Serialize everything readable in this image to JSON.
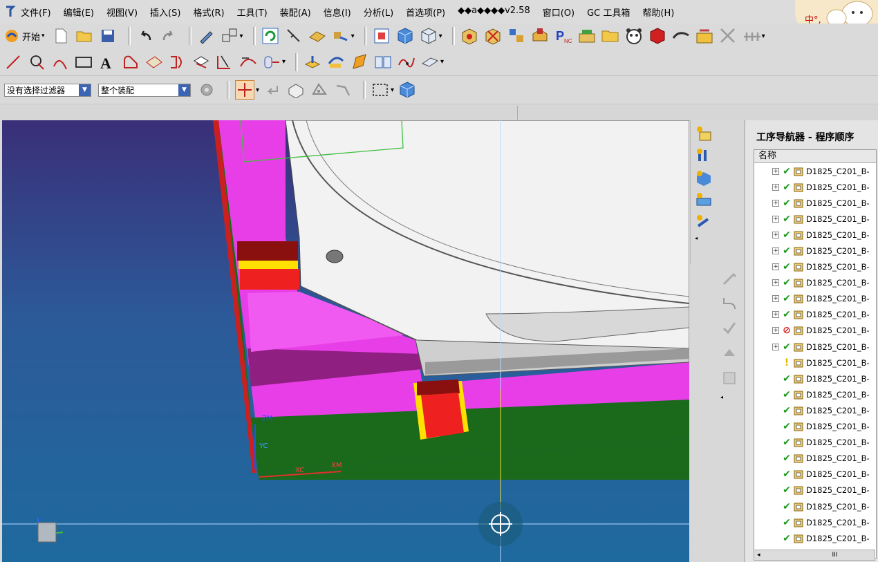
{
  "menu": {
    "items": [
      "文件(F)",
      "编辑(E)",
      "视图(V)",
      "插入(S)",
      "格式(R)",
      "工具(T)",
      "装配(A)",
      "信息(I)",
      "分析(L)",
      "首选项(P)",
      "◆◆a◆◆◆◆v2.58",
      "窗口(O)",
      "GC 工具箱",
      "帮助(H)"
    ]
  },
  "toolbar": {
    "start_label": "开始",
    "filter_value": "没有选择过滤器",
    "assembly_value": "整个装配"
  },
  "viewport": {
    "axis_labels": [
      "ZM",
      "YC",
      "XC",
      "XM"
    ],
    "background_top": "#3a2f78",
    "background_bottom": "#1e6a9e"
  },
  "navigator": {
    "title": "工序导航器 - 程序顺序",
    "column_header": "名称",
    "rows": [
      {
        "name": "D1825_C201_B-",
        "status": "check",
        "expandable": true
      },
      {
        "name": "D1825_C201_B-",
        "status": "check",
        "expandable": true
      },
      {
        "name": "D1825_C201_B-",
        "status": "check",
        "expandable": true
      },
      {
        "name": "D1825_C201_B-",
        "status": "check",
        "expandable": true
      },
      {
        "name": "D1825_C201_B-",
        "status": "check",
        "expandable": true
      },
      {
        "name": "D1825_C201_B-",
        "status": "check",
        "expandable": true
      },
      {
        "name": "D1825_C201_B-",
        "status": "check",
        "expandable": true
      },
      {
        "name": "D1825_C201_B-",
        "status": "check",
        "expandable": true
      },
      {
        "name": "D1825_C201_B-",
        "status": "check",
        "expandable": true
      },
      {
        "name": "D1825_C201_B-",
        "status": "check",
        "expandable": true
      },
      {
        "name": "D1825_C201_B-",
        "status": "blocked",
        "expandable": true
      },
      {
        "name": "D1825_C201_B-",
        "status": "check",
        "expandable": true
      },
      {
        "name": "D1825_C201_B-",
        "status": "warning",
        "expandable": false
      },
      {
        "name": "D1825_C201_B-",
        "status": "check",
        "expandable": false
      },
      {
        "name": "D1825_C201_B-",
        "status": "check",
        "expandable": false
      },
      {
        "name": "D1825_C201_B-",
        "status": "check",
        "expandable": false
      },
      {
        "name": "D1825_C201_B-",
        "status": "check",
        "expandable": false
      },
      {
        "name": "D1825_C201_B-",
        "status": "check",
        "expandable": false
      },
      {
        "name": "D1825_C201_B-",
        "status": "check",
        "expandable": false
      },
      {
        "name": "D1825_C201_B-",
        "status": "check",
        "expandable": false
      },
      {
        "name": "D1825_C201_B-",
        "status": "check",
        "expandable": false
      },
      {
        "name": "D1825_C201_B-",
        "status": "check",
        "expandable": false
      },
      {
        "name": "D1825_C201_B-",
        "status": "check",
        "expandable": false
      },
      {
        "name": "D1825_C201_B-",
        "status": "check",
        "expandable": false
      },
      {
        "name": "D1825_C201_B-",
        "status": "check",
        "expandable": false
      }
    ],
    "scroll_thumb": "III"
  },
  "ime": {
    "label": "中°,"
  },
  "colors": {
    "magenta": "#e83ee8",
    "green": "#1a6a1a",
    "red": "#e82020",
    "yellow": "#ffe000",
    "check": "#1a9a1a"
  }
}
